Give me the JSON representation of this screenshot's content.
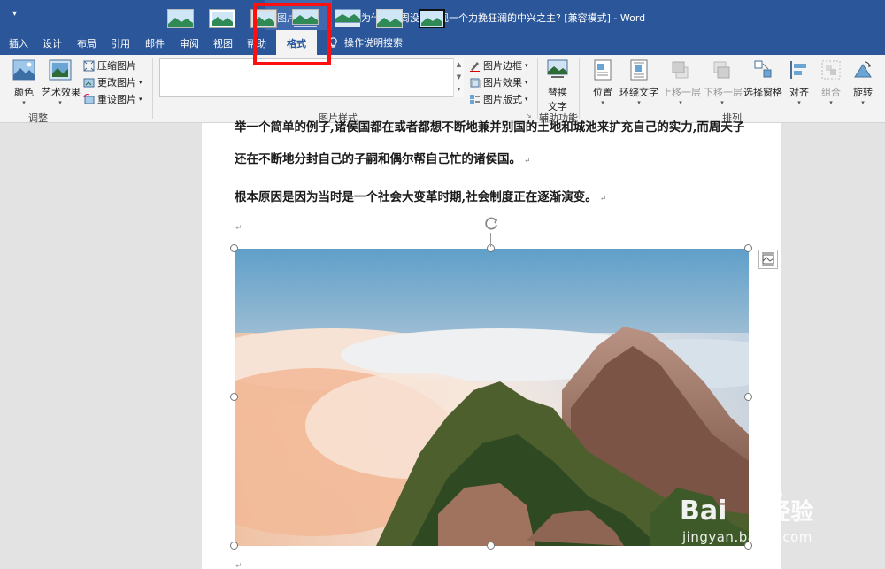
{
  "titlebar": {
    "qat_symbol": "▾",
    "context_group": "图片工具",
    "document_title": "为什么东周没能出现一个力挽狂澜的中兴之主?  [兼容模式]  -  Word"
  },
  "tabs": [
    {
      "label": "插入"
    },
    {
      "label": "设计"
    },
    {
      "label": "布局"
    },
    {
      "label": "引用"
    },
    {
      "label": "邮件"
    },
    {
      "label": "审阅"
    },
    {
      "label": "视图"
    },
    {
      "label": "帮助"
    },
    {
      "label": "格式"
    }
  ],
  "help": {
    "label": "操作说明搜索"
  },
  "ribbon": {
    "adjust": {
      "color": "颜色",
      "art_effects": "艺术效果",
      "compress": "压缩图片",
      "change": "更改图片",
      "reset": "重设图片",
      "group_label": "调整"
    },
    "styles": {
      "border": "图片边框",
      "effects": "图片效果",
      "layout": "图片版式",
      "group_label": "图片样式"
    },
    "accessibility": {
      "alt_text": "替换文字",
      "alt_text_line1": "替换",
      "alt_text_line2": "文字",
      "group_label": "辅助功能"
    },
    "arrange": {
      "position": "位置",
      "wrap": "环绕文字",
      "forward": "上移一层",
      "backward": "下移一层",
      "selection_pane": "选择窗格",
      "align": "对齐",
      "group": "组合",
      "rotate": "旋转",
      "group_label": "排列"
    }
  },
  "document": {
    "line1": "举一个简单的例子,诸侯国都在或者都想不断地兼并别国的土地和城池来扩充自己的实力,而周天子",
    "line2": "还在不断地分封自己的子嗣和偶尔帮自己忙的诸侯国。",
    "line3": "根本原因是因为当时是一个社会大变革时期,社会制度正在逐渐演变。",
    "para_mark": "↵"
  },
  "watermark": {
    "brand": "Bai",
    "brand2": "经验",
    "url": "jingyan.baidu.com"
  },
  "colors": {
    "word_blue": "#2b579a",
    "highlight_red": "#ff1010"
  }
}
